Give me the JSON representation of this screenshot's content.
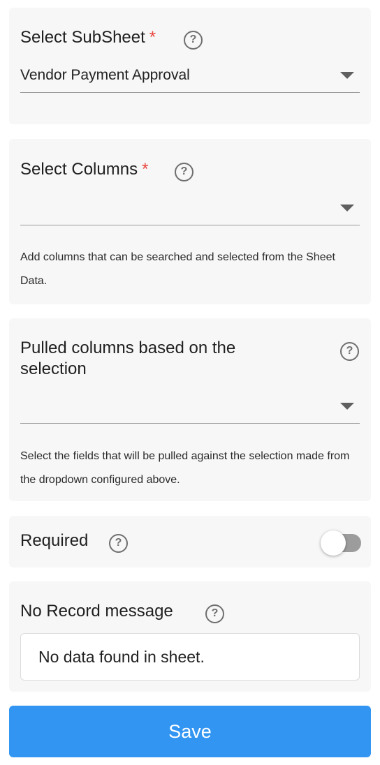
{
  "subsheet": {
    "label": "Select SubSheet",
    "required_mark": "*",
    "help": "?",
    "value": "Vendor Payment Approval"
  },
  "columns": {
    "label": "Select Columns",
    "required_mark": "*",
    "help": "?",
    "value": "",
    "hint": "Add columns that can be searched and selected from the Sheet Data."
  },
  "pulled": {
    "label_line1": "Pulled columns based on the",
    "label_line2": "selection",
    "help": "?",
    "value": "",
    "hint": "Select the fields that will be pulled against the selection made from the dropdown configured above."
  },
  "required": {
    "label": "Required",
    "help": "?",
    "enabled": false
  },
  "no_record": {
    "label": "No Record message",
    "help": "?",
    "value": "No data found in sheet."
  },
  "save_label": "Save",
  "colors": {
    "accent": "#3295f2",
    "required_mark": "#e8453c",
    "card_bg": "#f7f7f7"
  },
  "icons": {
    "help": "question-circle-icon",
    "caret": "caret-down-icon"
  }
}
